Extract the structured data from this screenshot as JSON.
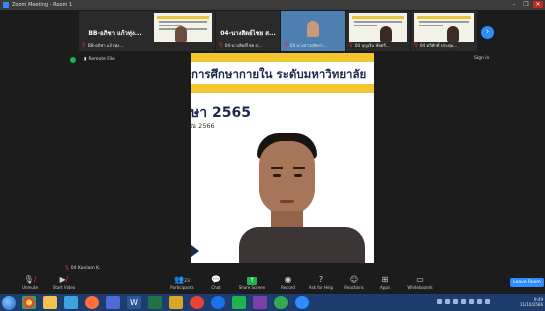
{
  "window": {
    "title": "Zoom Meeting - Room 1",
    "controls": [
      "–",
      "❐",
      "✕"
    ]
  },
  "thumbnails": [
    {
      "name": "BB-อภิชา แก้วทุ่ง..."
    },
    {
      "name": "04-นางสิตย์ไชย ส..."
    },
    {
      "name": "04 นางสาวสุจิตรา..."
    },
    {
      "name": "04 บุญเริ่ม ชัยศรี..."
    },
    {
      "name": "04 ทวีศักดิ์ ประทุม..."
    }
  ],
  "thumbnail_header": {
    "left": "BB-อภิชา แก้วทุ่ง...",
    "right": "04-นางสิตย์ไชย ส..."
  },
  "statusbar": {
    "remote_label": "Remote File",
    "signin_label": "Sign in"
  },
  "main_share": {
    "headline": "การศึกษากายใน ระดับมหาวิทยาลัย",
    "year": "ษา 2565",
    "sub": "ณ 2566"
  },
  "self_name": "04 Kanlam K.",
  "toolbar": {
    "items": [
      {
        "label": "Unmute",
        "icon": "microphone-muted-icon"
      },
      {
        "label": "Start Video",
        "icon": "video-off-icon"
      },
      {
        "label": "Participants",
        "icon": "participants-icon",
        "count": "23"
      },
      {
        "label": "Chat",
        "icon": "chat-icon"
      },
      {
        "label": "Share Screen",
        "icon": "share-screen-icon"
      },
      {
        "label": "Record",
        "icon": "record-icon"
      },
      {
        "label": "Ask for Help",
        "icon": "help-icon"
      },
      {
        "label": "Reactions",
        "icon": "reactions-icon"
      },
      {
        "label": "Apps",
        "icon": "apps-icon"
      },
      {
        "label": "Whiteboards",
        "icon": "whiteboard-icon"
      }
    ],
    "leave_label": "Leave Room"
  },
  "taskbar": {
    "time": "9:49",
    "date": "11/10/2566"
  },
  "colors": {
    "accent": "#2d8cff",
    "share_green": "#21b34b",
    "muted_red": "#e02828",
    "slide_yellow": "#f2c62f",
    "slide_navy": "#1c2a4e",
    "taskbar": "#1d3d6e"
  }
}
